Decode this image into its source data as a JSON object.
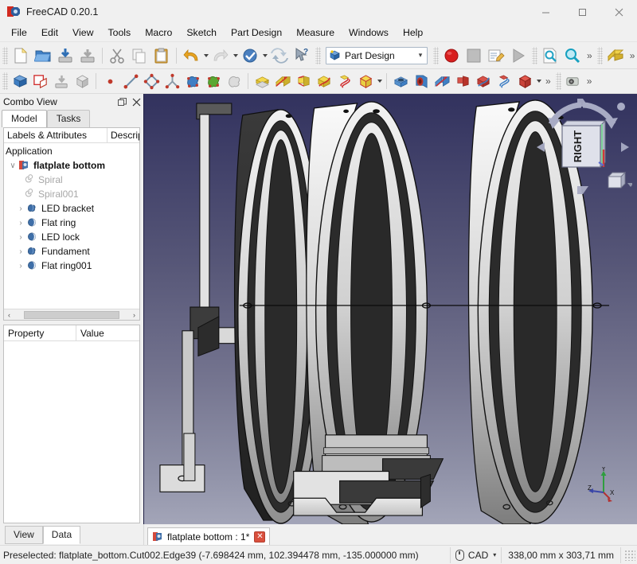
{
  "window": {
    "title": "FreeCAD 0.20.1",
    "icon": "freecad-logo-icon",
    "minimize_label": "─",
    "maximize_label": "□",
    "close_label": "✕"
  },
  "menubar": {
    "items": [
      {
        "label": "File"
      },
      {
        "label": "Edit"
      },
      {
        "label": "View"
      },
      {
        "label": "Tools"
      },
      {
        "label": "Macro"
      },
      {
        "label": "Sketch"
      },
      {
        "label": "Part Design"
      },
      {
        "label": "Measure"
      },
      {
        "label": "Windows"
      },
      {
        "label": "Help"
      }
    ]
  },
  "toolbars": {
    "file": [
      {
        "name": "new-document-button",
        "title": "New"
      },
      {
        "name": "open-document-button",
        "title": "Open"
      },
      {
        "name": "save-document-button",
        "title": "Save"
      },
      {
        "name": "save-as-document-button",
        "title": "Save As"
      },
      {
        "name": "cut-button",
        "title": "Cut"
      },
      {
        "name": "copy-button",
        "title": "Copy"
      },
      {
        "name": "paste-button",
        "title": "Paste"
      },
      {
        "name": "undo-button",
        "title": "Undo"
      },
      {
        "name": "redo-button",
        "title": "Redo"
      },
      {
        "name": "refresh-button",
        "title": "Refresh"
      },
      {
        "name": "std-refresh-button",
        "title": "Std Refresh"
      },
      {
        "name": "whats-this-button",
        "title": "What's This"
      }
    ],
    "workbench": {
      "selected": "Part Design",
      "arrow": "▾"
    },
    "macro": [
      {
        "name": "macro-record-button",
        "title": "Macro recording"
      },
      {
        "name": "macro-stop-button",
        "title": "Stop macro recording"
      },
      {
        "name": "macro-edit-button",
        "title": "Macros"
      },
      {
        "name": "macro-execute-button",
        "title": "Execute macro"
      }
    ],
    "view": [
      {
        "name": "fit-all-button",
        "title": "Fit all"
      },
      {
        "name": "zoom-button",
        "title": "Zoom"
      }
    ],
    "overflow_label": "»",
    "structure": [
      {
        "name": "create-part-button",
        "title": "Create part"
      },
      {
        "name": "create-group-button",
        "title": "Create group"
      },
      {
        "name": "make-link-button",
        "title": "Make link"
      },
      {
        "name": "create-box-button",
        "title": "Create box"
      }
    ],
    "sketcher": [
      {
        "name": "create-point-button",
        "title": "Point"
      },
      {
        "name": "create-line-button",
        "title": "Line"
      },
      {
        "name": "create-polyline-button",
        "title": "Polyline"
      },
      {
        "name": "create-datum-button",
        "title": "Datum"
      },
      {
        "name": "create-shapebinder-button",
        "title": "Shape binder"
      },
      {
        "name": "create-subshapebinder-button",
        "title": "Sub-object shape binder"
      },
      {
        "name": "create-clone-button",
        "title": "Clone"
      }
    ],
    "additive": [
      {
        "name": "pad-button",
        "title": "Pad"
      },
      {
        "name": "revolution-button",
        "title": "Revolution"
      },
      {
        "name": "additive-loft-button",
        "title": "Additive loft"
      },
      {
        "name": "additive-pipe-button",
        "title": "Additive pipe"
      },
      {
        "name": "additive-helix-button",
        "title": "Additive helix"
      },
      {
        "name": "additive-primitive-button",
        "title": "Additive primitive"
      }
    ],
    "subtractive": [
      {
        "name": "pocket-button",
        "title": "Pocket"
      },
      {
        "name": "hole-button",
        "title": "Hole"
      },
      {
        "name": "groove-button",
        "title": "Groove"
      },
      {
        "name": "subtractive-loft-button",
        "title": "Subtractive loft"
      },
      {
        "name": "subtractive-pipe-button",
        "title": "Subtractive pipe"
      },
      {
        "name": "subtractive-helix-button",
        "title": "Subtractive helix"
      },
      {
        "name": "subtractive-primitive-button",
        "title": "Subtractive primitive"
      }
    ],
    "measure": [
      {
        "name": "measure-button",
        "title": "Measure"
      }
    ]
  },
  "combo_view": {
    "title": "Combo View",
    "float_label": "❐",
    "close_label": "✕",
    "tabs": [
      {
        "label": "Model",
        "active": true
      },
      {
        "label": "Tasks",
        "active": false
      }
    ],
    "tree": {
      "columns": [
        "Labels & Attributes",
        "Descriptio"
      ],
      "root": "Application",
      "items": [
        {
          "label": "flatplate bottom",
          "indent": 0,
          "twisty": "∨",
          "icon": "document-icon",
          "bold": true,
          "dim": false
        },
        {
          "label": "Spiral",
          "indent": 1,
          "twisty": "",
          "icon": "spiral-icon",
          "bold": false,
          "dim": true
        },
        {
          "label": "Spiral001",
          "indent": 1,
          "twisty": "",
          "icon": "spiral-icon",
          "bold": false,
          "dim": true
        },
        {
          "label": "LED bracket",
          "indent": 1,
          "twisty": "›",
          "icon": "body-icon",
          "bold": false,
          "dim": false
        },
        {
          "label": "Flat ring",
          "indent": 1,
          "twisty": "›",
          "icon": "part-icon",
          "bold": false,
          "dim": false
        },
        {
          "label": "LED lock",
          "indent": 1,
          "twisty": "›",
          "icon": "part-icon",
          "bold": false,
          "dim": false
        },
        {
          "label": "Fundament",
          "indent": 1,
          "twisty": "›",
          "icon": "body-icon",
          "bold": false,
          "dim": false
        },
        {
          "label": "Flat ring001",
          "indent": 1,
          "twisty": "›",
          "icon": "part-icon",
          "bold": false,
          "dim": false
        }
      ],
      "scroll_left_arrow": "‹",
      "scroll_right_arrow": "›"
    },
    "property_editor": {
      "columns": [
        "Property",
        "Value"
      ],
      "rows": []
    },
    "bottom_tabs": [
      {
        "label": "View",
        "active": false
      },
      {
        "label": "Data",
        "active": true
      }
    ]
  },
  "viewport": {
    "nav_cube_face": "RIGHT",
    "axis_labels": {
      "x": "X",
      "y": "Y",
      "z": "Z"
    },
    "background_top": "#32325e",
    "background_bottom": "#a3a5b8"
  },
  "document_tabs": [
    {
      "label": "flatplate bottom : 1*",
      "close_label": "✕",
      "active": true
    }
  ],
  "statusbar": {
    "message": "Preselected: flatplate_bottom.Cut002.Edge39 (-7.698424 mm, 102.394478 mm, -135.000000 mm)",
    "nav_style": "CAD",
    "nav_arrow": "▾",
    "dimensions": "338,00 mm x 303,71 mm"
  }
}
